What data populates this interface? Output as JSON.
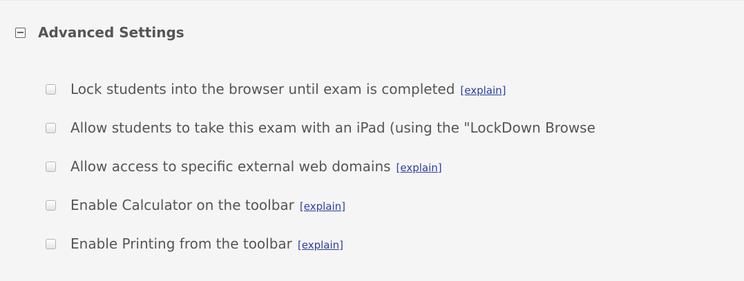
{
  "section": {
    "title": "Advanced Settings",
    "collapse_icon": "collapse-minus-icon"
  },
  "options": [
    {
      "label": "Lock students into the browser until exam is completed",
      "explain": "[explain]",
      "checked": false
    },
    {
      "label": "Allow students to take this exam with an iPad (using the \"LockDown Browse",
      "explain": "",
      "checked": false
    },
    {
      "label": "Allow access to specific external web domains",
      "explain": "[explain]",
      "checked": false
    },
    {
      "label": "Enable Calculator on the toolbar",
      "explain": "[explain]",
      "checked": false
    },
    {
      "label": "Enable Printing from the toolbar",
      "explain": "[explain]",
      "checked": false
    }
  ]
}
